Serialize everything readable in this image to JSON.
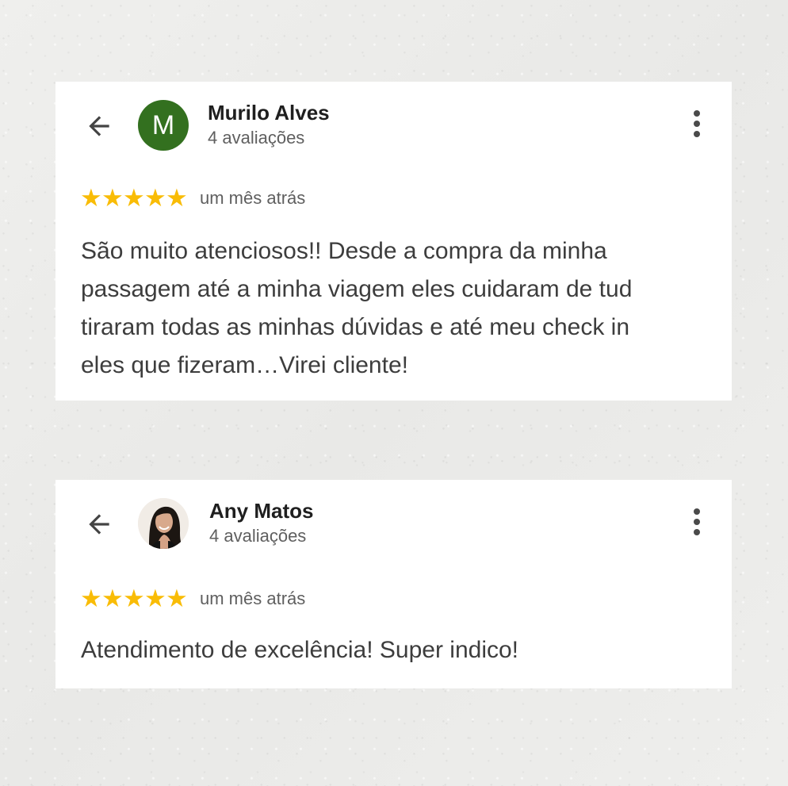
{
  "reviews": [
    {
      "author": "Murilo Alves",
      "avatar_type": "letter",
      "avatar_letter": "M",
      "avatar_color": "#33701f",
      "review_count": "4 avaliações",
      "rating": 5,
      "time_ago": "um mês atrás",
      "text_lines": [
        "São muito atenciosos!! Desde a compra da minha",
        "passagem até a minha viagem eles cuidaram de tud",
        "tiraram todas as minhas dúvidas e até meu check in",
        "eles que fizeram…Virei cliente!"
      ]
    },
    {
      "author": "Any Matos",
      "avatar_type": "photo",
      "review_count": "4 avaliações",
      "rating": 5,
      "time_ago": "um mês atrás",
      "text_lines": [
        "Atendimento de excelência! Super indico!"
      ]
    }
  ],
  "icons": {
    "back": "arrow-back-icon",
    "more": "more-vert-icon",
    "star": "star-icon"
  },
  "colors": {
    "star": "#f9bc06",
    "card_background": "#ffffff",
    "page_background": "#ededeb"
  }
}
